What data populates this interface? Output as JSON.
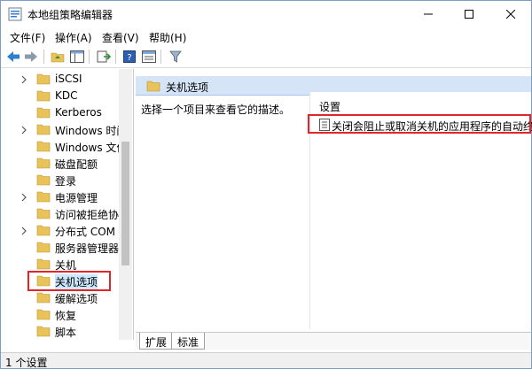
{
  "window": {
    "title": "本地组策略编辑器"
  },
  "menu": [
    "文件(F)",
    "操作(A)",
    "查看(V)",
    "帮助(H)"
  ],
  "tree": {
    "items": [
      {
        "label": "iSCSI",
        "has_arrow": true,
        "selected": false
      },
      {
        "label": "KDC",
        "has_arrow": false,
        "selected": false
      },
      {
        "label": "Kerberos",
        "has_arrow": false,
        "selected": false
      },
      {
        "label": "Windows 时间",
        "has_arrow": true,
        "selected": false
      },
      {
        "label": "Windows 文件",
        "has_arrow": false,
        "selected": false
      },
      {
        "label": "磁盘配额",
        "has_arrow": false,
        "selected": false
      },
      {
        "label": "登录",
        "has_arrow": false,
        "selected": false
      },
      {
        "label": "电源管理",
        "has_arrow": true,
        "selected": false
      },
      {
        "label": "访问被拒绝协助",
        "has_arrow": false,
        "selected": false
      },
      {
        "label": "分布式 COM",
        "has_arrow": true,
        "selected": false
      },
      {
        "label": "服务器管理器",
        "has_arrow": false,
        "selected": false
      },
      {
        "label": "关机",
        "has_arrow": false,
        "selected": false
      },
      {
        "label": "关机选项",
        "has_arrow": false,
        "selected": true
      },
      {
        "label": "缓解选项",
        "has_arrow": false,
        "selected": false
      },
      {
        "label": "恢复",
        "has_arrow": false,
        "selected": false
      },
      {
        "label": "脚本",
        "has_arrow": false,
        "selected": false
      }
    ]
  },
  "right": {
    "header": "关机选项",
    "description": "选择一个项目来查看它的描述。",
    "settings_header": "设置",
    "settings": [
      "关闭会阻止或取消关机的应用程序的自动终止功能"
    ]
  },
  "tabs": [
    "扩展",
    "标准"
  ],
  "status": "1 个设置",
  "colors": {
    "highlight_box": "#e0262b",
    "pane_header": "#d5e5f7",
    "folder": "#e8c35a"
  }
}
